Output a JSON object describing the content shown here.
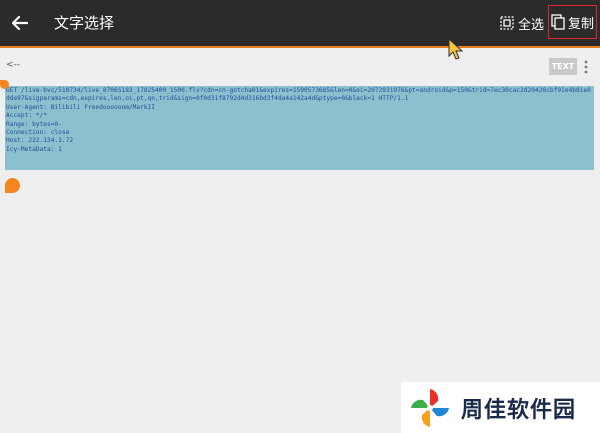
{
  "appbar": {
    "title": "文字选择",
    "select_all_label": "全选",
    "copy_label": "复制"
  },
  "toolbar": {
    "breadcrumb": "<--",
    "text_button_label": "TEXT"
  },
  "selected_text": "GET /live-bvc/510734/live_8706S183_17825400_1500.flv?cdn=cn-gotcha01&expires=1590573685&len=0&oi=2072931976&pt=android&p=150&trid=7ec30cac2d20420cbf91e4b81e0dde97&sigparams=cdn,expires,len,oi,pt,qn,trid&sign=0f0d31f8792d4d316bd3f4da4a142a4d&ptype=0&black=1 HTTP/1.1\nUser-Agent: Bilibili Freedoooooom/MarkII\nAccept: */*\nRange: bytes=0-\nConnection: close\nHost: 222.134.1.72\nIcy-MetaData: 1",
  "colors": {
    "appbar_bg": "#2b2b2b",
    "accent": "#e87d1e",
    "selection_bg": "#8bc1cf",
    "copy_border": "#e0262b"
  },
  "watermark": {
    "text": "周佳软件园"
  }
}
